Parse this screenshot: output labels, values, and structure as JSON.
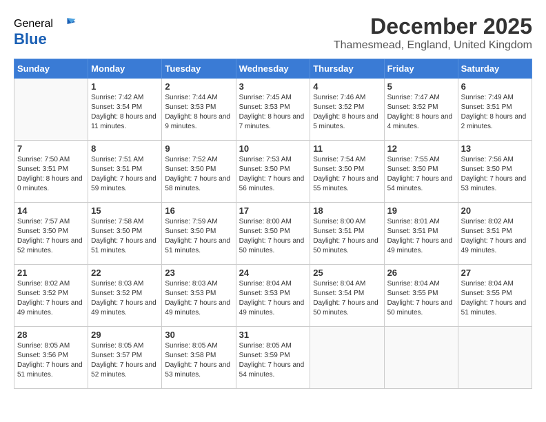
{
  "logo": {
    "general": "General",
    "blue": "Blue"
  },
  "title": {
    "month_year": "December 2025",
    "location": "Thamesmead, England, United Kingdom"
  },
  "weekdays": [
    "Sunday",
    "Monday",
    "Tuesday",
    "Wednesday",
    "Thursday",
    "Friday",
    "Saturday"
  ],
  "weeks": [
    [
      {
        "day": "",
        "sunrise": "",
        "sunset": "",
        "daylight": ""
      },
      {
        "day": "1",
        "sunrise": "7:42 AM",
        "sunset": "3:54 PM",
        "daylight": "8 hours and 11 minutes."
      },
      {
        "day": "2",
        "sunrise": "7:44 AM",
        "sunset": "3:53 PM",
        "daylight": "8 hours and 9 minutes."
      },
      {
        "day": "3",
        "sunrise": "7:45 AM",
        "sunset": "3:53 PM",
        "daylight": "8 hours and 7 minutes."
      },
      {
        "day": "4",
        "sunrise": "7:46 AM",
        "sunset": "3:52 PM",
        "daylight": "8 hours and 5 minutes."
      },
      {
        "day": "5",
        "sunrise": "7:47 AM",
        "sunset": "3:52 PM",
        "daylight": "8 hours and 4 minutes."
      },
      {
        "day": "6",
        "sunrise": "7:49 AM",
        "sunset": "3:51 PM",
        "daylight": "8 hours and 2 minutes."
      }
    ],
    [
      {
        "day": "7",
        "sunrise": "7:50 AM",
        "sunset": "3:51 PM",
        "daylight": "8 hours and 0 minutes."
      },
      {
        "day": "8",
        "sunrise": "7:51 AM",
        "sunset": "3:51 PM",
        "daylight": "7 hours and 59 minutes."
      },
      {
        "day": "9",
        "sunrise": "7:52 AM",
        "sunset": "3:50 PM",
        "daylight": "7 hours and 58 minutes."
      },
      {
        "day": "10",
        "sunrise": "7:53 AM",
        "sunset": "3:50 PM",
        "daylight": "7 hours and 56 minutes."
      },
      {
        "day": "11",
        "sunrise": "7:54 AM",
        "sunset": "3:50 PM",
        "daylight": "7 hours and 55 minutes."
      },
      {
        "day": "12",
        "sunrise": "7:55 AM",
        "sunset": "3:50 PM",
        "daylight": "7 hours and 54 minutes."
      },
      {
        "day": "13",
        "sunrise": "7:56 AM",
        "sunset": "3:50 PM",
        "daylight": "7 hours and 53 minutes."
      }
    ],
    [
      {
        "day": "14",
        "sunrise": "7:57 AM",
        "sunset": "3:50 PM",
        "daylight": "7 hours and 52 minutes."
      },
      {
        "day": "15",
        "sunrise": "7:58 AM",
        "sunset": "3:50 PM",
        "daylight": "7 hours and 51 minutes."
      },
      {
        "day": "16",
        "sunrise": "7:59 AM",
        "sunset": "3:50 PM",
        "daylight": "7 hours and 51 minutes."
      },
      {
        "day": "17",
        "sunrise": "8:00 AM",
        "sunset": "3:50 PM",
        "daylight": "7 hours and 50 minutes."
      },
      {
        "day": "18",
        "sunrise": "8:00 AM",
        "sunset": "3:51 PM",
        "daylight": "7 hours and 50 minutes."
      },
      {
        "day": "19",
        "sunrise": "8:01 AM",
        "sunset": "3:51 PM",
        "daylight": "7 hours and 49 minutes."
      },
      {
        "day": "20",
        "sunrise": "8:02 AM",
        "sunset": "3:51 PM",
        "daylight": "7 hours and 49 minutes."
      }
    ],
    [
      {
        "day": "21",
        "sunrise": "8:02 AM",
        "sunset": "3:52 PM",
        "daylight": "7 hours and 49 minutes."
      },
      {
        "day": "22",
        "sunrise": "8:03 AM",
        "sunset": "3:52 PM",
        "daylight": "7 hours and 49 minutes."
      },
      {
        "day": "23",
        "sunrise": "8:03 AM",
        "sunset": "3:53 PM",
        "daylight": "7 hours and 49 minutes."
      },
      {
        "day": "24",
        "sunrise": "8:04 AM",
        "sunset": "3:53 PM",
        "daylight": "7 hours and 49 minutes."
      },
      {
        "day": "25",
        "sunrise": "8:04 AM",
        "sunset": "3:54 PM",
        "daylight": "7 hours and 50 minutes."
      },
      {
        "day": "26",
        "sunrise": "8:04 AM",
        "sunset": "3:55 PM",
        "daylight": "7 hours and 50 minutes."
      },
      {
        "day": "27",
        "sunrise": "8:04 AM",
        "sunset": "3:55 PM",
        "daylight": "7 hours and 51 minutes."
      }
    ],
    [
      {
        "day": "28",
        "sunrise": "8:05 AM",
        "sunset": "3:56 PM",
        "daylight": "7 hours and 51 minutes."
      },
      {
        "day": "29",
        "sunrise": "8:05 AM",
        "sunset": "3:57 PM",
        "daylight": "7 hours and 52 minutes."
      },
      {
        "day": "30",
        "sunrise": "8:05 AM",
        "sunset": "3:58 PM",
        "daylight": "7 hours and 53 minutes."
      },
      {
        "day": "31",
        "sunrise": "8:05 AM",
        "sunset": "3:59 PM",
        "daylight": "7 hours and 54 minutes."
      },
      {
        "day": "",
        "sunrise": "",
        "sunset": "",
        "daylight": ""
      },
      {
        "day": "",
        "sunrise": "",
        "sunset": "",
        "daylight": ""
      },
      {
        "day": "",
        "sunrise": "",
        "sunset": "",
        "daylight": ""
      }
    ]
  ]
}
